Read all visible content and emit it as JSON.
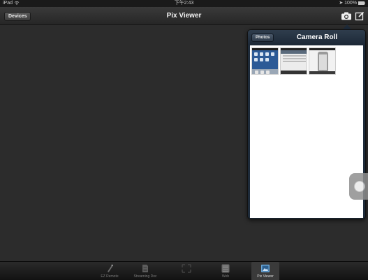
{
  "status_bar": {
    "carrier": "iPad",
    "time": "下午2:43",
    "battery": "100%"
  },
  "nav_bar": {
    "back_label": "Devices",
    "title": "Pix Viewer",
    "camera_icon": "camera-icon",
    "compose_icon": "compose-icon"
  },
  "popover": {
    "back_label": "Photos",
    "title": "Camera Roll",
    "thumbnails": [
      "photo",
      "photo",
      "photo"
    ]
  },
  "tab_bar": {
    "items": [
      {
        "label": "EZ Remote",
        "icon": "remote-icon"
      },
      {
        "label": "Streaming Doc",
        "icon": "document-icon"
      },
      {
        "label": "",
        "icon": "expand-icon"
      },
      {
        "label": "Web",
        "icon": "web-icon"
      },
      {
        "label": "Pix Viewer",
        "icon": "pix-viewer-icon"
      }
    ]
  }
}
